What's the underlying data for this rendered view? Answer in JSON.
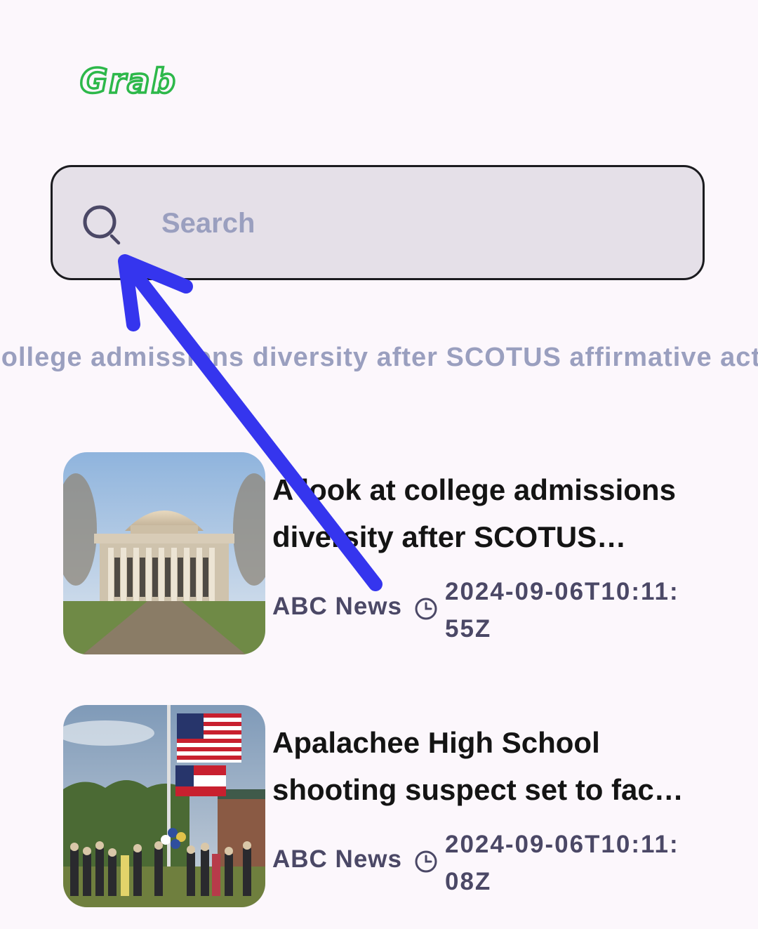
{
  "app": {
    "logo_text": "Grab"
  },
  "search": {
    "placeholder": "Search",
    "value": ""
  },
  "ticker": {
    "text": "A look at college admissions diversity after SCOTUS affirmative action ruling"
  },
  "articles": [
    {
      "title": "A look at college admissions diversity after SCOTUS affirmative action ruling",
      "source": "ABC News",
      "published": "2024-09-06T10:11:55Z",
      "image": "university-dome-building"
    },
    {
      "title": "Apalachee High School shooting suspect set to face judge",
      "source": "ABC News",
      "published": "2024-09-06T10:11:08Z",
      "image": "flags-at-half-staff-vigil"
    }
  ],
  "colors": {
    "background": "#fcf7fc",
    "brand_green": "#2db84a",
    "search_fill": "#e5e0e8",
    "muted_text": "#9a9fbf",
    "meta_text": "#4b4866",
    "annotation_arrow": "#3535ee"
  }
}
